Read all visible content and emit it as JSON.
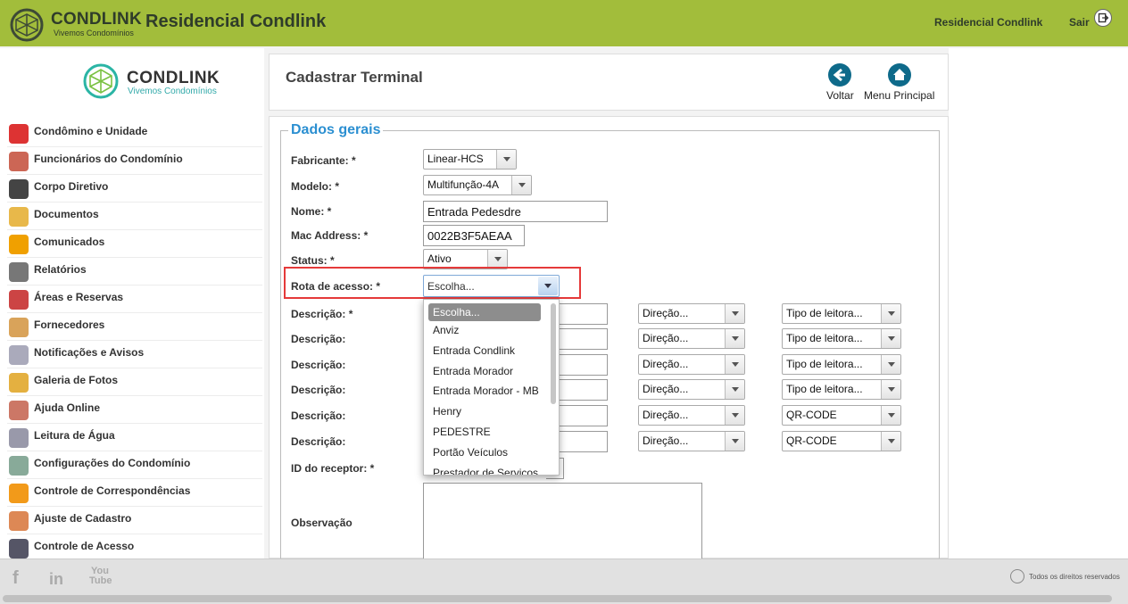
{
  "header": {
    "brand": "CONDLINK",
    "brand_sub": "Vivemos Condomínios",
    "app_title": "Residencial Condlink",
    "condominium": "Residencial Condlink",
    "logout": "Sair"
  },
  "sidebar": {
    "brand": "CONDLINK",
    "brand_sub": "Vivemos Condomínios",
    "items": [
      {
        "label": "Condômino e Unidade",
        "icon": "resident-icon",
        "color": "#d33"
      },
      {
        "label": "Funcionários do Condomínio",
        "icon": "employees-icon",
        "color": "#c65"
      },
      {
        "label": "Corpo Diretivo",
        "icon": "board-icon",
        "color": "#444"
      },
      {
        "label": "Documentos",
        "icon": "documents-icon",
        "color": "#e8b84a"
      },
      {
        "label": "Comunicados",
        "icon": "announcement-icon",
        "color": "#f0a000"
      },
      {
        "label": "Relatórios",
        "icon": "reports-icon",
        "color": "#777"
      },
      {
        "label": "Áreas e Reservas",
        "icon": "calendar-icon",
        "color": "#c44"
      },
      {
        "label": "Fornecedores",
        "icon": "handshake-icon",
        "color": "#d9a35a"
      },
      {
        "label": "Notificações e Avisos",
        "icon": "notification-icon",
        "color": "#aab"
      },
      {
        "label": "Galeria de Fotos",
        "icon": "gallery-icon",
        "color": "#e4b040"
      },
      {
        "label": "Ajuda Online",
        "icon": "help-icon",
        "color": "#c76"
      },
      {
        "label": "Leitura de Água",
        "icon": "water-icon",
        "color": "#99a"
      },
      {
        "label": "Configurações do Condomínio",
        "icon": "settings-icon",
        "color": "#8a9"
      },
      {
        "label": "Controle de Correspondências",
        "icon": "mail-icon",
        "color": "#f29a1a"
      },
      {
        "label": "Ajuste de Cadastro",
        "icon": "register-icon",
        "color": "#d85"
      },
      {
        "label": "Controle de Acesso",
        "icon": "access-icon",
        "color": "#556"
      }
    ]
  },
  "page": {
    "title": "Cadastrar Terminal",
    "back_label": "Voltar",
    "home_label": "Menu Principal",
    "accent": "#0e6a8a"
  },
  "form": {
    "legend": "Dados gerais",
    "fabricante_label": "Fabricante: *",
    "fabricante_value": "Linear-HCS",
    "modelo_label": "Modelo: *",
    "modelo_value": "Multifunção-4A",
    "nome_label": "Nome: *",
    "nome_value": "Entrada Pedesdre",
    "mac_label": "Mac Address: *",
    "mac_value": "0022B3F5AEAA",
    "status_label": "Status: *",
    "status_value": "Ativo",
    "rota_label": "Rota de acesso: *",
    "rota_value": "Escolha...",
    "descricoes": [
      {
        "label": "Descrição: *",
        "direcao": "Direção...",
        "leitora": "Tipo de leitora..."
      },
      {
        "label": "Descrição:",
        "direcao": "Direção...",
        "leitora": "Tipo de leitora..."
      },
      {
        "label": "Descrição:",
        "direcao": "Direção...",
        "leitora": "Tipo de leitora..."
      },
      {
        "label": "Descrição:",
        "direcao": "Direção...",
        "leitora": "Tipo de leitora..."
      },
      {
        "label": "Descrição:",
        "direcao": "Direção...",
        "leitora": "QR-CODE"
      },
      {
        "label": "Descrição:",
        "direcao": "Direção...",
        "leitora": "QR-CODE"
      }
    ],
    "receptor_label": "ID do receptor: *",
    "observacao_label": "Observação"
  },
  "dropdown": {
    "options": [
      "Escolha...",
      "Anviz",
      "Entrada Condlink",
      "Entrada Morador",
      "Entrada Morador - MB",
      "Henry",
      "PEDESTRE",
      "Portão Veículos",
      "Prestador de Serviços"
    ]
  },
  "footer": {
    "facebook": "f",
    "linkedin": "in",
    "youtube": "You Tube",
    "rights": "Todos os direitos reservados"
  }
}
